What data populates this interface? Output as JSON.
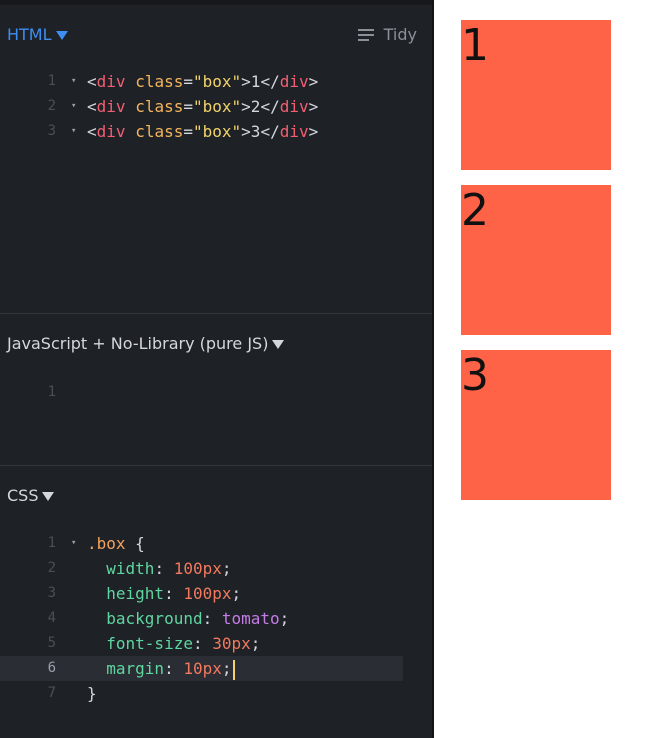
{
  "html_panel": {
    "title": "HTML",
    "tidy_label": "Tidy",
    "lines": [
      {
        "num": "1",
        "tokens": [
          [
            "t-txt",
            "<"
          ],
          [
            "t-tag",
            "div"
          ],
          [
            "t-txt",
            " "
          ],
          [
            "t-attr",
            "class"
          ],
          [
            "t-txt",
            "="
          ],
          [
            "t-str",
            "\"box\""
          ],
          [
            "t-txt",
            ">1</"
          ],
          [
            "t-tag",
            "div"
          ],
          [
            "t-txt",
            ">"
          ]
        ]
      },
      {
        "num": "2",
        "tokens": [
          [
            "t-txt",
            "<"
          ],
          [
            "t-tag",
            "div"
          ],
          [
            "t-txt",
            " "
          ],
          [
            "t-attr",
            "class"
          ],
          [
            "t-txt",
            "="
          ],
          [
            "t-str",
            "\"box\""
          ],
          [
            "t-txt",
            ">2</"
          ],
          [
            "t-tag",
            "div"
          ],
          [
            "t-txt",
            ">"
          ]
        ]
      },
      {
        "num": "3",
        "tokens": [
          [
            "t-txt",
            "<"
          ],
          [
            "t-tag",
            "div"
          ],
          [
            "t-txt",
            " "
          ],
          [
            "t-attr",
            "class"
          ],
          [
            "t-txt",
            "="
          ],
          [
            "t-str",
            "\"box\""
          ],
          [
            "t-txt",
            ">3</"
          ],
          [
            "t-tag",
            "div"
          ],
          [
            "t-txt",
            ">"
          ]
        ]
      }
    ]
  },
  "js_panel": {
    "title": "JavaScript + No-Library (pure JS)",
    "lines": [
      {
        "num": "1",
        "tokens": []
      }
    ]
  },
  "css_panel": {
    "title": "CSS",
    "lines": [
      {
        "num": "1",
        "tokens": [
          [
            "t-sel",
            ".box"
          ],
          [
            "t-txt",
            " {"
          ]
        ]
      },
      {
        "num": "2",
        "tokens": [
          [
            "t-txt",
            "  "
          ],
          [
            "t-prop",
            "width"
          ],
          [
            "t-txt",
            ": "
          ],
          [
            "t-num",
            "100px"
          ],
          [
            "t-txt",
            ";"
          ]
        ]
      },
      {
        "num": "3",
        "tokens": [
          [
            "t-txt",
            "  "
          ],
          [
            "t-prop",
            "height"
          ],
          [
            "t-txt",
            ": "
          ],
          [
            "t-num",
            "100px"
          ],
          [
            "t-txt",
            ";"
          ]
        ]
      },
      {
        "num": "4",
        "tokens": [
          [
            "t-txt",
            "  "
          ],
          [
            "t-prop",
            "background"
          ],
          [
            "t-txt",
            ": "
          ],
          [
            "t-kw",
            "tomato"
          ],
          [
            "t-txt",
            ";"
          ]
        ]
      },
      {
        "num": "5",
        "tokens": [
          [
            "t-txt",
            "  "
          ],
          [
            "t-prop",
            "font-size"
          ],
          [
            "t-txt",
            ": "
          ],
          [
            "t-num",
            "30px"
          ],
          [
            "t-txt",
            ";"
          ]
        ]
      },
      {
        "num": "6",
        "tokens": [
          [
            "t-txt",
            "  "
          ],
          [
            "t-prop",
            "margin"
          ],
          [
            "t-txt",
            ": "
          ],
          [
            "t-num",
            "10px"
          ],
          [
            "t-txt",
            ";"
          ]
        ]
      },
      {
        "num": "7",
        "tokens": [
          [
            "t-txt",
            "}"
          ]
        ]
      }
    ]
  },
  "result": {
    "boxes": [
      "1",
      "2",
      "3"
    ],
    "box_color": "#ff6347"
  },
  "icons": {
    "dropdown": "triangle-down-icon",
    "tidy": "lines-icon",
    "fold": "fold-triangle-icon"
  },
  "colors": {
    "accent": "#3d8ef0",
    "editor_bg": "#1e2126"
  }
}
